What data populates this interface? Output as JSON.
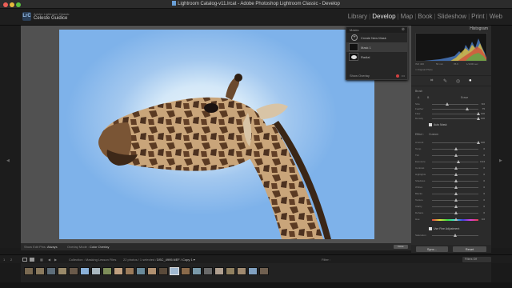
{
  "window": {
    "title": "Lightroom Catalog-v11.lrcat - Adobe Photoshop Lightroom Classic - Develop"
  },
  "identity": {
    "logo": "LrC",
    "small": "Adobe Lightroom Classic",
    "name": "Celeste Guidice"
  },
  "modules": [
    "Library",
    "Develop",
    "Map",
    "Book",
    "Slideshow",
    "Print",
    "Web"
  ],
  "active_module": "Develop",
  "masks_panel": {
    "title": "Masks",
    "create_new": "Create New Mask",
    "mask_label": "Mask 1",
    "oval_label": "Radial",
    "show_overlay": "Show Overlay"
  },
  "toolbar": {
    "show_edit_pins_label": "Show Edit Pins :",
    "show_edit_pins_value": "Always",
    "overlay_mode_label": "Overlay Mode :",
    "overlay_mode_value": "Color Overlay",
    "done": "Done"
  },
  "right_panel": {
    "histogram_title": "Histogram",
    "histo_info": [
      "ISO 400",
      "50 mm",
      "f/5.6",
      "1/1000 sec"
    ],
    "original_photo": "Original Photo",
    "brush": {
      "title": "Brush",
      "mode_a": "A",
      "mode_b": "B",
      "erase": "Erase",
      "rows": [
        {
          "label": "Size",
          "value": "8.0",
          "pos": 0.3
        },
        {
          "label": "Feather",
          "value": "75",
          "pos": 0.75
        },
        {
          "label": "Flow",
          "value": "100",
          "pos": 1.0
        },
        {
          "label": "Density",
          "value": "100",
          "pos": 1.0
        }
      ],
      "auto_mask": "Auto Mask"
    },
    "effect": {
      "label": "Effect :",
      "value": "Custom",
      "rows": [
        {
          "label": "Amount",
          "value": "100",
          "pos": 1.0
        },
        {
          "label": "Temp",
          "value": "0",
          "pos": 0.5
        },
        {
          "label": "Tint",
          "value": "0",
          "pos": 0.5
        },
        {
          "label": "Exposure",
          "value": "0.24",
          "pos": 0.56
        },
        {
          "label": "Contrast",
          "value": "0",
          "pos": 0.5
        },
        {
          "label": "Highlights",
          "value": "0",
          "pos": 0.5
        },
        {
          "label": "Shadows",
          "value": "0",
          "pos": 0.5
        },
        {
          "label": "Whites",
          "value": "0",
          "pos": 0.5
        },
        {
          "label": "Blacks",
          "value": "0",
          "pos": 0.5
        },
        {
          "label": "Texture",
          "value": "0",
          "pos": 0.5
        },
        {
          "label": "Clarity",
          "value": "0",
          "pos": 0.5
        },
        {
          "label": "Dehaze",
          "value": "0",
          "pos": 0.5
        },
        {
          "label": "Hue",
          "value": "0.0",
          "pos": 0.5
        }
      ],
      "fine_adjust": "Use Fine Adjustment",
      "saturation": "Saturation"
    },
    "sync": "Sync...",
    "reset": "Reset"
  },
  "filmstrip_bar": {
    "collection": "Collection : Masking Lesson Files",
    "count": "22 photos / 1 selected /",
    "file": "DSC_4995.NEF / Copy 1 ▾",
    "filter_label": "Filter :",
    "filter_value": "Filters Off"
  },
  "colors": {
    "accent": "#e6e6e6",
    "sky": "#7eb2ea"
  }
}
